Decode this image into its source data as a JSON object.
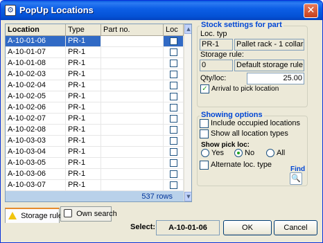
{
  "window": {
    "title": "PopUp Locations",
    "app_icon": "app-icon",
    "close_icon": "close-icon"
  },
  "grid": {
    "columns": [
      "Location",
      "Type",
      "Part no.",
      "Loc"
    ],
    "rows": [
      {
        "location": "A-10-01-06",
        "type": "PR-1",
        "part": "",
        "occupied": false,
        "selected": true
      },
      {
        "location": "A-10-01-07",
        "type": "PR-1",
        "part": "",
        "occupied": false
      },
      {
        "location": "A-10-01-08",
        "type": "PR-1",
        "part": "",
        "occupied": false
      },
      {
        "location": "A-10-02-03",
        "type": "PR-1",
        "part": "",
        "occupied": false
      },
      {
        "location": "A-10-02-04",
        "type": "PR-1",
        "part": "",
        "occupied": false
      },
      {
        "location": "A-10-02-05",
        "type": "PR-1",
        "part": "",
        "occupied": false
      },
      {
        "location": "A-10-02-06",
        "type": "PR-1",
        "part": "",
        "occupied": false
      },
      {
        "location": "A-10-02-07",
        "type": "PR-1",
        "part": "",
        "occupied": false
      },
      {
        "location": "A-10-02-08",
        "type": "PR-1",
        "part": "",
        "occupied": false
      },
      {
        "location": "A-10-03-03",
        "type": "PR-1",
        "part": "",
        "occupied": false
      },
      {
        "location": "A-10-03-04",
        "type": "PR-1",
        "part": "",
        "occupied": false
      },
      {
        "location": "A-10-03-05",
        "type": "PR-1",
        "part": "",
        "occupied": false
      },
      {
        "location": "A-10-03-06",
        "type": "PR-1",
        "part": "",
        "occupied": false
      },
      {
        "location": "A-10-03-07",
        "type": "PR-1",
        "part": "",
        "occupied": false
      }
    ],
    "row_count": "537 rows"
  },
  "tabs": [
    {
      "label": "Storage rule",
      "icon": "warning-icon",
      "active": true
    },
    {
      "label": "Own search",
      "icon": "search-icon",
      "active": false
    }
  ],
  "stock_settings": {
    "legend": "Stock settings for part",
    "loc_typ_label": "Loc. typ",
    "loc_typ_code": "PR-1",
    "loc_typ_desc": "Pallet rack - 1 collar",
    "storage_rule_label": "Storage rule:",
    "storage_rule_code": "0",
    "storage_rule_desc": "Default storage rule",
    "qty_label": "Qty/loc:",
    "qty_value": "25.00",
    "arrival_label": "Arrival to pick location",
    "arrival_checked": true
  },
  "showing_options": {
    "legend": "Showing options",
    "include_occupied": "Include occupied locations",
    "show_all_types": "Show all location types",
    "show_pick_label": "Show pick loc:",
    "radio_yes": "Yes",
    "radio_no": "No",
    "radio_all": "All",
    "radio_selected": "No",
    "alternate_label": "Alternate loc. type",
    "find_label": "Find"
  },
  "footer": {
    "select_label": "Select:",
    "select_value": "A-10-01-06",
    "ok_label": "OK",
    "cancel_label": "Cancel"
  },
  "colors": {
    "selection": "#316ac5",
    "legend_blue": "#0046d5",
    "title_blue": "#0a5ae0"
  }
}
